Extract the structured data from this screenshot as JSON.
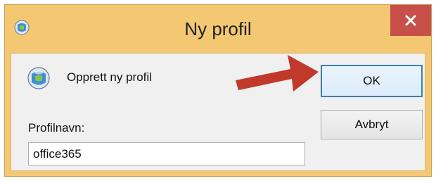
{
  "window": {
    "title": "Ny profil",
    "close_icon": "close-x-icon",
    "app_icon": "outlook-mail-globe-icon",
    "accent_close": "#c7504a",
    "frame_color": "#f4c872"
  },
  "dialog": {
    "heading": "Opprett ny profil",
    "heading_icon": "outlook-mail-globe-icon",
    "field_label": "Profilnavn:",
    "field_value": "office365",
    "ok_label": "OK",
    "cancel_label": "Avbryt",
    "annotation": {
      "icon": "red-arrow-pointer",
      "color": "#c0392b"
    }
  }
}
